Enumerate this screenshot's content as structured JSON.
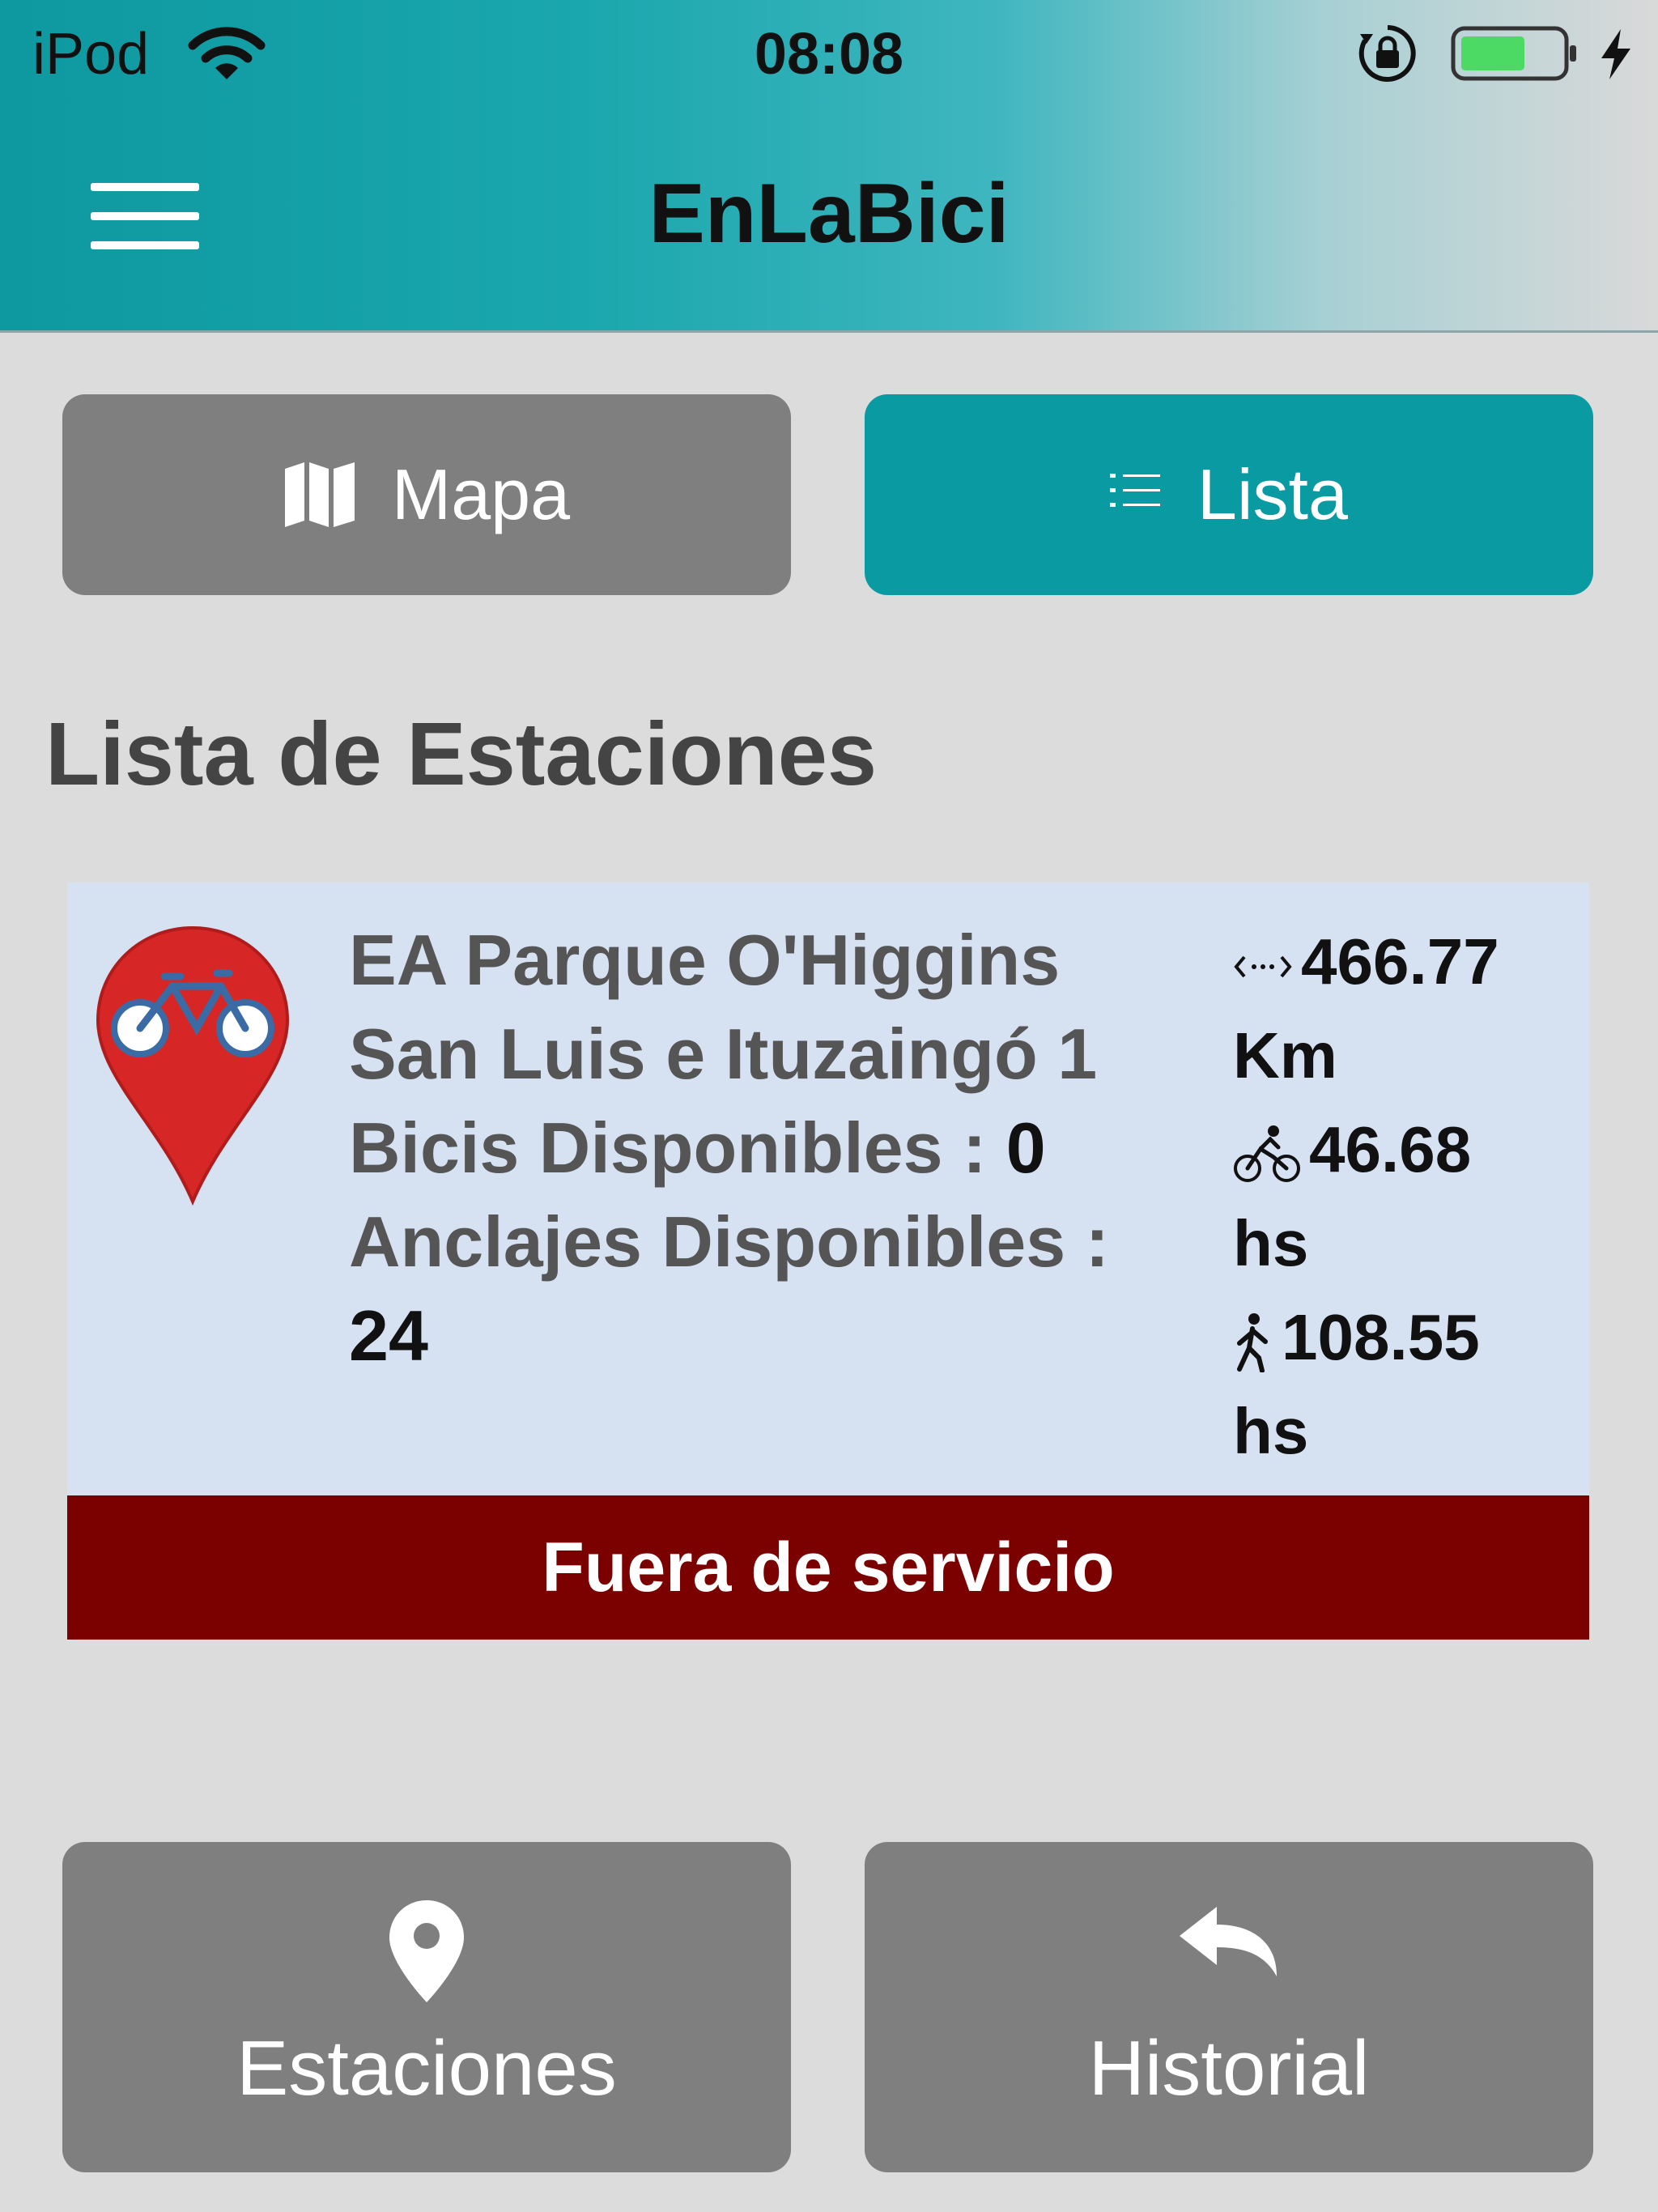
{
  "status_bar": {
    "carrier": "iPod",
    "time": "08:08",
    "icons": [
      "wifi-icon",
      "rotation-lock-icon",
      "battery-icon",
      "charging-bolt-icon"
    ]
  },
  "header": {
    "title": "EnLaBici",
    "menu_icon": "hamburger-menu-icon"
  },
  "segments": {
    "map": {
      "label": "Mapa",
      "icon": "map-icon"
    },
    "list": {
      "label": "Lista",
      "icon": "list-icon"
    }
  },
  "section_title": "Lista de Estaciones",
  "stations": [
    {
      "name": "EA Parque O'Higgins",
      "address": "San Luis e Ituzaingó 1",
      "bikes_label": "Bicis Disponibles : ",
      "bikes_value": "0",
      "docks_label": "Anclajes Disponibles : ",
      "docks_value": "24",
      "distance": "466.77",
      "distance_unit": "Km",
      "bike_time": "46.68",
      "bike_time_unit": "hs",
      "walk_time": "108.55",
      "walk_time_unit": "hs",
      "status": "Fuera de servicio",
      "icon": "bike-pin-icon"
    }
  ],
  "bottom_nav": {
    "stations": {
      "label": "Estaciones",
      "icon": "location-pin-icon"
    },
    "history": {
      "label": "Historial",
      "icon": "reply-arrow-icon"
    }
  },
  "colors": {
    "accent": "#0a9aa2",
    "inactive_button": "#7f7f7f",
    "card_bg": "#d6e1f1",
    "out_of_service": "#7b0000",
    "pin_red": "#d62626"
  }
}
